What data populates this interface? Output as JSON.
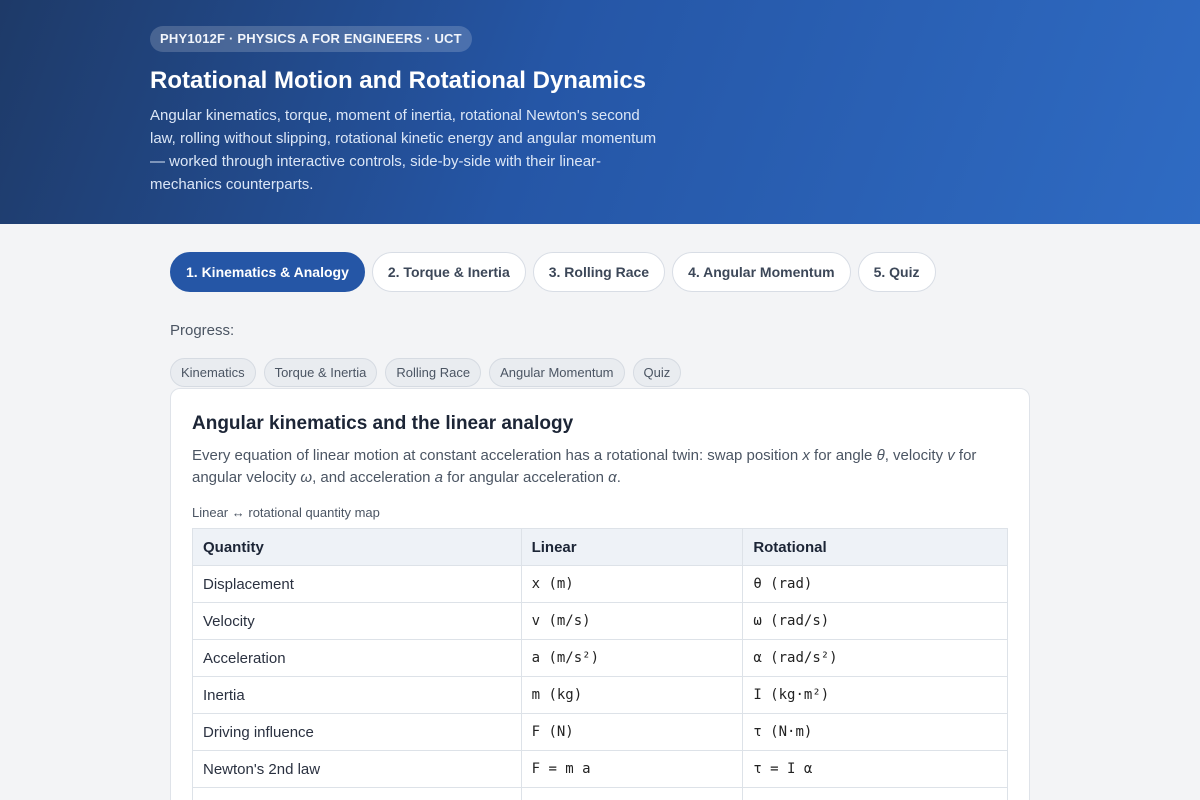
{
  "header": {
    "course_badge": "PHY1012F · PHYSICS A FOR ENGINEERS · UCT",
    "title": "Rotational Motion and Rotational Dynamics",
    "subtitle": "Angular kinematics, torque, moment of inertia, rotational Newton's second law, rolling without slipping, rotational kinetic energy and angular momentum — worked through interactive controls, side-by-side with their linear-mechanics counterparts."
  },
  "tabs": [
    {
      "label": "1. Kinematics & Analogy",
      "active": true
    },
    {
      "label": "2. Torque & Inertia",
      "active": false
    },
    {
      "label": "3. Rolling Race",
      "active": false
    },
    {
      "label": "4. Angular Momentum",
      "active": false
    },
    {
      "label": "5. Quiz",
      "active": false
    }
  ],
  "progress": {
    "label": "Progress:",
    "chips": [
      "Kinematics",
      "Torque & Inertia",
      "Rolling Race",
      "Angular Momentum",
      "Quiz"
    ]
  },
  "section": {
    "title": "Angular kinematics and the linear analogy",
    "intro": {
      "p1": "Every equation of linear motion at constant acceleration has a rotational twin: swap position ",
      "x": "x",
      "p2": " for angle ",
      "theta": "θ",
      "p3": ", velocity ",
      "v": "v",
      "p4": " for angular velocity ",
      "omega": "ω",
      "p5": ", and acceleration ",
      "a": "a",
      "p6": " for angular acceleration ",
      "alpha": "α",
      "p7": "."
    },
    "table_caption": "Linear ↔ rotational quantity map",
    "table": {
      "headers": [
        "Quantity",
        "Linear",
        "Rotational"
      ],
      "rows": [
        [
          "Displacement",
          "x (m)",
          "θ (rad)"
        ],
        [
          "Velocity",
          "v (m/s)",
          "ω (rad/s)"
        ],
        [
          "Acceleration",
          "a (m/s²)",
          "α (rad/s²)"
        ],
        [
          "Inertia",
          "m (kg)",
          "I (kg·m²)"
        ],
        [
          "Driving influence",
          "F (N)",
          "τ (N·m)"
        ],
        [
          "Newton's 2nd law",
          "F = m a",
          "τ = I α"
        ]
      ]
    }
  }
}
